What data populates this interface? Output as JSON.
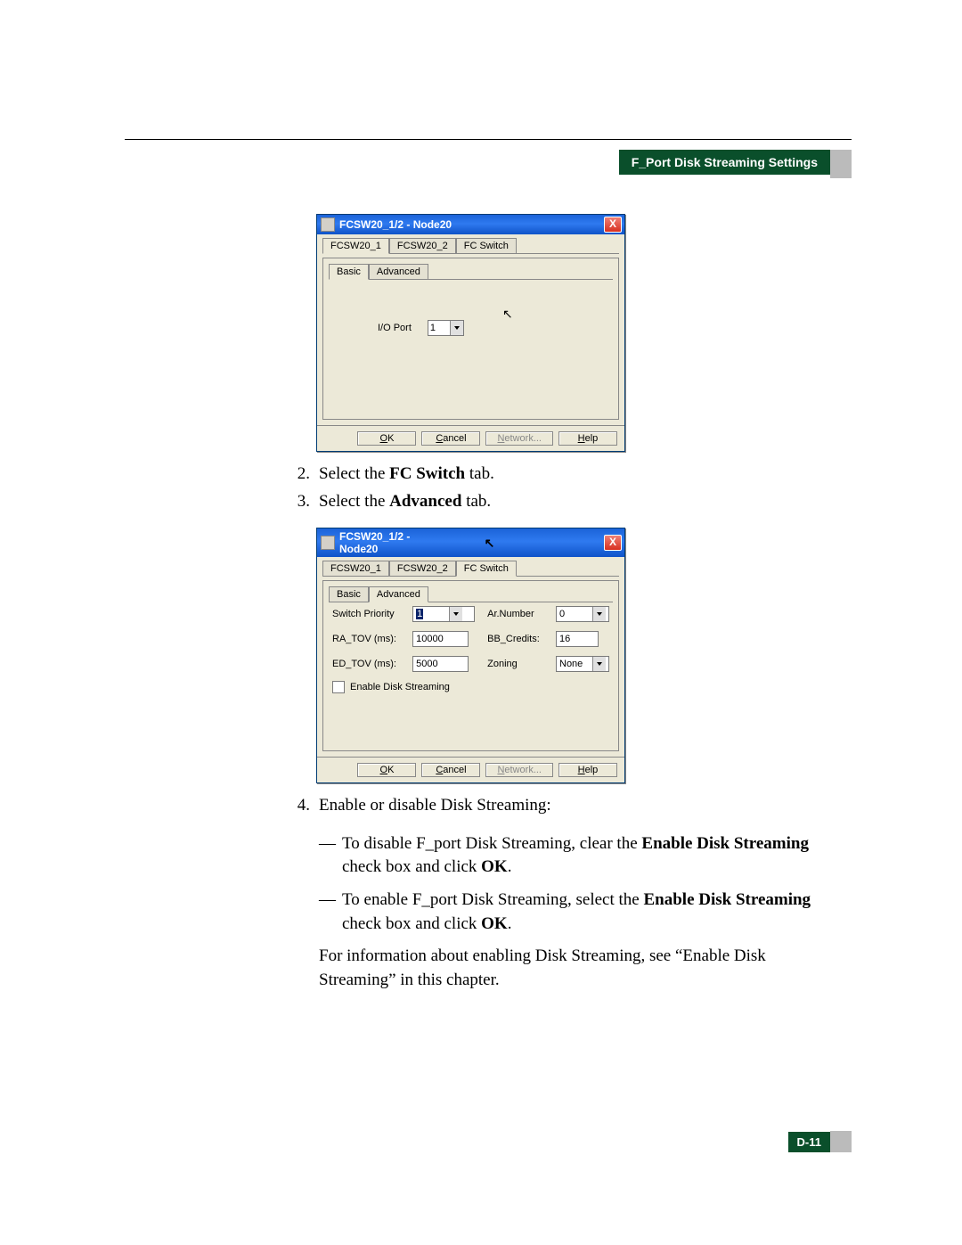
{
  "header": {
    "section_title": "F_Port Disk Streaming Settings"
  },
  "page_number": "D-11",
  "dialog1": {
    "title": "FCSW20_1/2 - Node20",
    "tabs": [
      "FCSW20_1",
      "FCSW20_2",
      "FC Switch"
    ],
    "active_tab": 0,
    "subtabs": [
      "Basic",
      "Advanced"
    ],
    "active_subtab": 0,
    "io_port_label": "I/O Port",
    "io_port_value": "1",
    "buttons": {
      "ok": "OK",
      "cancel": "Cancel",
      "network": "Network...",
      "help": "Help"
    }
  },
  "dialog2": {
    "title": "FCSW20_1/2 - Node20",
    "tabs": [
      "FCSW20_1",
      "FCSW20_2",
      "FC Switch"
    ],
    "active_tab": 2,
    "subtabs": [
      "Basic",
      "Advanced"
    ],
    "active_subtab": 1,
    "fields": {
      "switch_priority_label": "Switch Priority",
      "switch_priority_value": "1",
      "ar_number_label": "Ar.Number",
      "ar_number_value": "0",
      "ra_tov_label": "RA_TOV (ms):",
      "ra_tov_value": "10000",
      "bb_credits_label": "BB_Credits:",
      "bb_credits_value": "16",
      "ed_tov_label": "ED_TOV (ms):",
      "ed_tov_value": "5000",
      "zoning_label": "Zoning",
      "zoning_value": "None",
      "enable_disk_streaming_label": "Enable Disk Streaming"
    },
    "buttons": {
      "ok": "OK",
      "cancel": "Cancel",
      "network": "Network...",
      "help": "Help"
    }
  },
  "steps": {
    "s2_pre": "Select the ",
    "s2_bold": "FC Switch",
    "s2_post": " tab.",
    "s3_pre": "Select the ",
    "s3_bold": "Advanced",
    "s3_post": " tab.",
    "s4": "Enable or disable Disk Streaming:",
    "s4a_pre": "To disable F_port Disk Streaming, clear the ",
    "s4a_bold": "Enable Disk Streaming",
    "s4a_mid": " check box and click ",
    "s4a_bold2": "OK",
    "s4a_post": ".",
    "s4b_pre": "To enable F_port Disk Streaming, select the ",
    "s4b_bold": "Enable Disk Streaming",
    "s4b_mid": " check box and click ",
    "s4b_bold2": "OK",
    "s4b_post": ".",
    "s4_note": "For information about enabling Disk Streaming, see “Enable Disk Streaming” in this chapter."
  }
}
